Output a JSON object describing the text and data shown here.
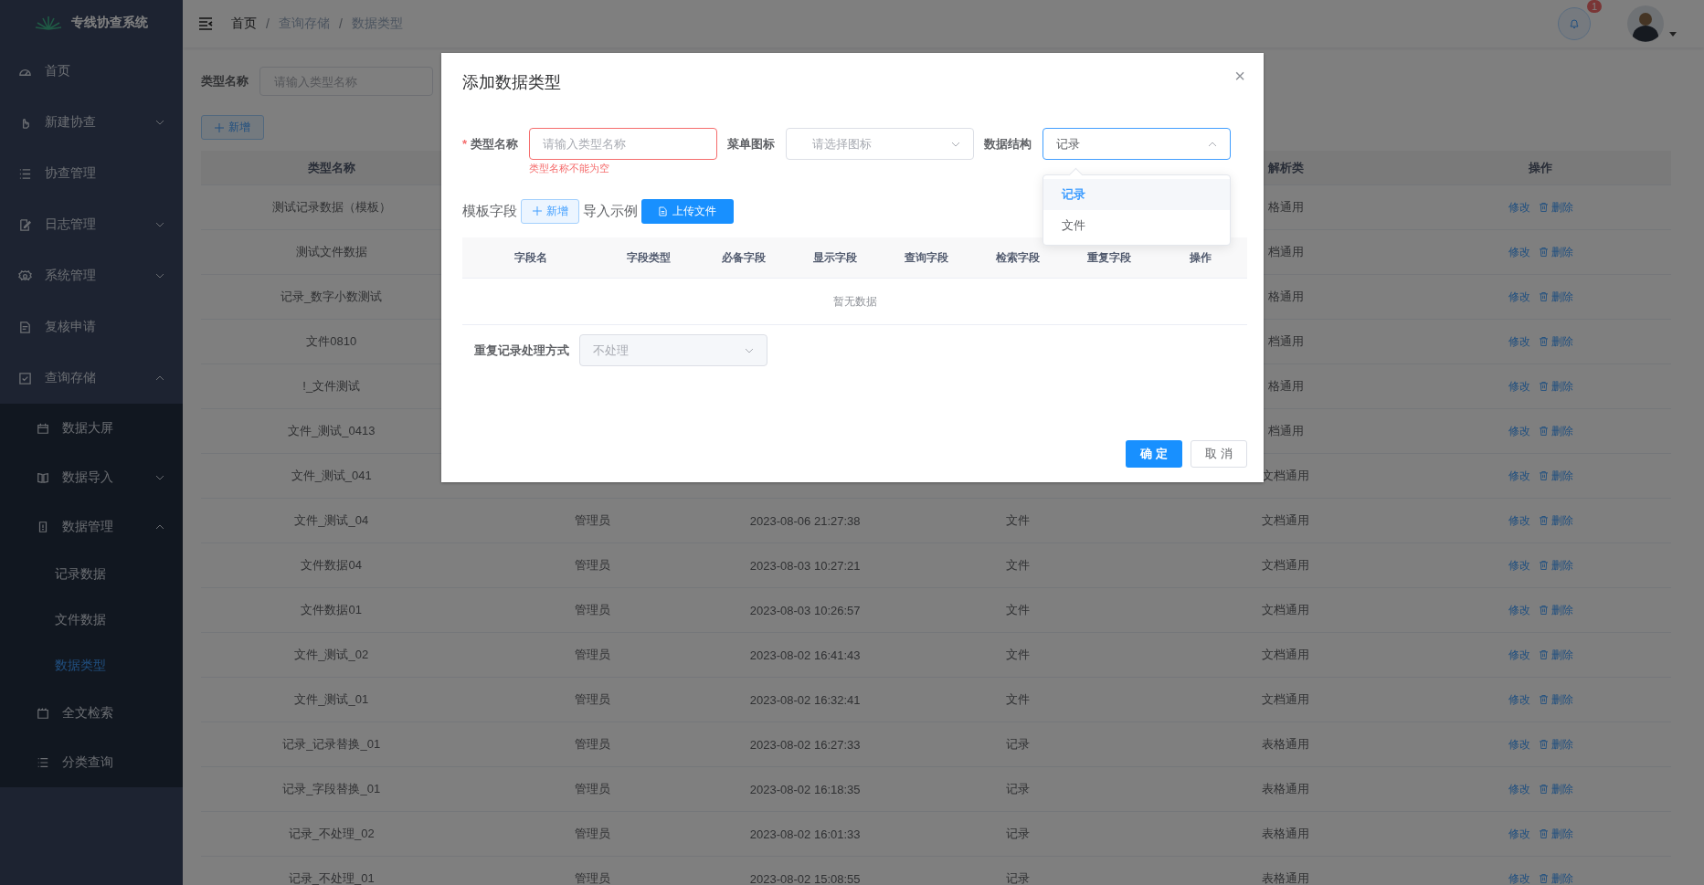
{
  "sidebar": {
    "logo_text": "专线协查系统",
    "items": [
      {
        "label": "首页",
        "selected": false
      },
      {
        "label": "新建协查",
        "selected": false,
        "expanded": false
      },
      {
        "label": "协查管理",
        "selected": false
      },
      {
        "label": "日志管理",
        "selected": false,
        "expanded": false
      },
      {
        "label": "系统管理",
        "selected": false,
        "expanded": false
      },
      {
        "label": "复核申请",
        "selected": false
      },
      {
        "label": "查询存储",
        "selected": false,
        "expanded": true,
        "children": [
          {
            "label": "数据大屏",
            "selected": false
          },
          {
            "label": "数据导入",
            "selected": false,
            "expanded": false
          },
          {
            "label": "数据管理",
            "selected": false,
            "expanded": true,
            "children": [
              {
                "label": "记录数据",
                "selected": false
              },
              {
                "label": "文件数据",
                "selected": false
              },
              {
                "label": "数据类型",
                "selected": true
              }
            ]
          },
          {
            "label": "全文检索",
            "selected": false
          },
          {
            "label": "分类查询",
            "selected": false
          }
        ]
      }
    ]
  },
  "header": {
    "breadcrumb": [
      {
        "label": "首页",
        "link": true
      },
      {
        "label": "查询存储",
        "link": false
      },
      {
        "label": "数据类型",
        "link": false
      }
    ],
    "separator": "/",
    "notification_badge": "1"
  },
  "filter": {
    "label": "类型名称",
    "placeholder": "请输入类型名称"
  },
  "add_button": "新增",
  "table": {
    "header": {
      "column_1": "类型名称",
      "column_5": "解析类",
      "column_6": "操作"
    },
    "rows": [
      {
        "column_1": "测试记录数据（模板）",
        "column_5": "格通用",
        "edit": "修改",
        "delete": "删除"
      },
      {
        "column_1": "测试文件数据",
        "column_5": "档通用",
        "edit": "修改",
        "delete": "删除"
      },
      {
        "column_1": "记录_数字小数测试",
        "column_5": "格通用",
        "edit": "修改",
        "delete": "删除"
      },
      {
        "column_1": "文件0810",
        "column_5": "档通用",
        "edit": "修改",
        "delete": "删除"
      },
      {
        "column_1": "!_文件测试",
        "column_5": "格通用",
        "edit": "修改",
        "delete": "删除"
      },
      {
        "column_1": "文件_测试_0413",
        "column_5": "档通用",
        "edit": "修改",
        "delete": "删除"
      },
      {
        "column_1": "文件_测试_041",
        "column_5": "文档通用",
        "edit": "修改",
        "delete": "删除"
      },
      {
        "column_1": "文件_测试_04",
        "column_2": "管理员",
        "column_3": "2023-08-06 21:27:38",
        "column_4": "文件",
        "column_5": "文档通用",
        "edit": "修改",
        "delete": "删除"
      },
      {
        "column_1": "文件数据04",
        "column_2": "管理员",
        "column_3": "2023-08-03 10:27:21",
        "column_4": "文件",
        "column_5": "文档通用",
        "edit": "修改",
        "delete": "删除"
      },
      {
        "column_1": "文件数据01",
        "column_2": "管理员",
        "column_3": "2023-08-03 10:26:57",
        "column_4": "文件",
        "column_5": "文档通用",
        "edit": "修改",
        "delete": "删除"
      },
      {
        "column_1": "文件_测试_02",
        "column_2": "管理员",
        "column_3": "2023-08-02 16:41:43",
        "column_4": "文件",
        "column_5": "文档通用",
        "edit": "修改",
        "delete": "删除"
      },
      {
        "column_1": "文件_测试_01",
        "column_2": "管理员",
        "column_3": "2023-08-02 16:32:41",
        "column_4": "文件",
        "column_5": "文档通用",
        "edit": "修改",
        "delete": "删除"
      },
      {
        "column_1": "记录_记录替换_01",
        "column_2": "管理员",
        "column_3": "2023-08-02 16:27:33",
        "column_4": "记录",
        "column_5": "表格通用",
        "edit": "修改",
        "delete": "删除"
      },
      {
        "column_1": "记录_字段替换_01",
        "column_2": "管理员",
        "column_3": "2023-08-02 16:18:35",
        "column_4": "记录",
        "column_5": "表格通用",
        "edit": "修改",
        "delete": "删除"
      },
      {
        "column_1": "记录_不处理_02",
        "column_2": "管理员",
        "column_3": "2023-08-02 16:01:33",
        "column_4": "记录",
        "column_5": "表格通用",
        "edit": "修改",
        "delete": "删除"
      },
      {
        "column_1": "记录_不处理_01",
        "column_2": "管理员",
        "column_3": "2023-08-02 15:08:55",
        "column_4": "记录",
        "column_5": "表格通用",
        "edit": "修改",
        "delete": "删除"
      }
    ]
  },
  "dialog": {
    "title": "添加数据类型",
    "close": "×",
    "required_mark": "*",
    "fields": [
      {
        "kind": "input",
        "label": "类型名称",
        "required": true,
        "placeholder": "请输入类型名称",
        "error": "类型名称不能为空"
      },
      {
        "kind": "select",
        "label": "菜单图标",
        "required": false,
        "placeholder": "请选择图标",
        "expanded": false
      },
      {
        "kind": "select",
        "label": "数据结构",
        "required": false,
        "value": "记录",
        "expanded": true,
        "options": [
          {
            "label": "记录",
            "selected": true
          },
          {
            "label": "文件",
            "selected": false
          }
        ]
      }
    ],
    "template_label": "模板字段",
    "add_button": "新增",
    "import_label": "导入示例",
    "upload_button": "上传文件",
    "field_table": {
      "columns": [
        "字段名",
        "字段类型",
        "必备字段",
        "显示字段",
        "查询字段",
        "检索字段",
        "重复字段",
        "操作"
      ],
      "empty_text": "暂无数据"
    },
    "duplicate": {
      "label": "重复记录处理方式",
      "value": "不处理",
      "disabled": true
    },
    "confirm_button": "确 定",
    "cancel_button": "取 消"
  }
}
